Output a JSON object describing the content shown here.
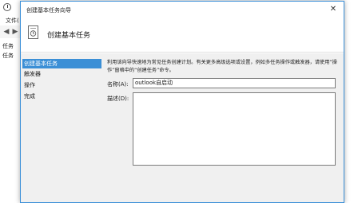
{
  "background_window": {
    "menu_label": "文件(",
    "tree_item_1": "任务",
    "tree_item_2": "任务"
  },
  "dialog": {
    "title": "创建基本任务向导",
    "close_glyph": "✕",
    "header_title": "创建基本任务",
    "steps": [
      {
        "label": "创建基本任务"
      },
      {
        "label": "触发器"
      },
      {
        "label": "操作"
      },
      {
        "label": "完成"
      }
    ],
    "description": "利用该向导快速地为常见任务创建计划。有关更多高级选项或设置，例如多任务操作或触发器，请使用“操作”窗格中的“创建任务”命令。",
    "name_label": "名称(A):",
    "name_value": "outlook自启动",
    "description_label": "描述(D):"
  }
}
